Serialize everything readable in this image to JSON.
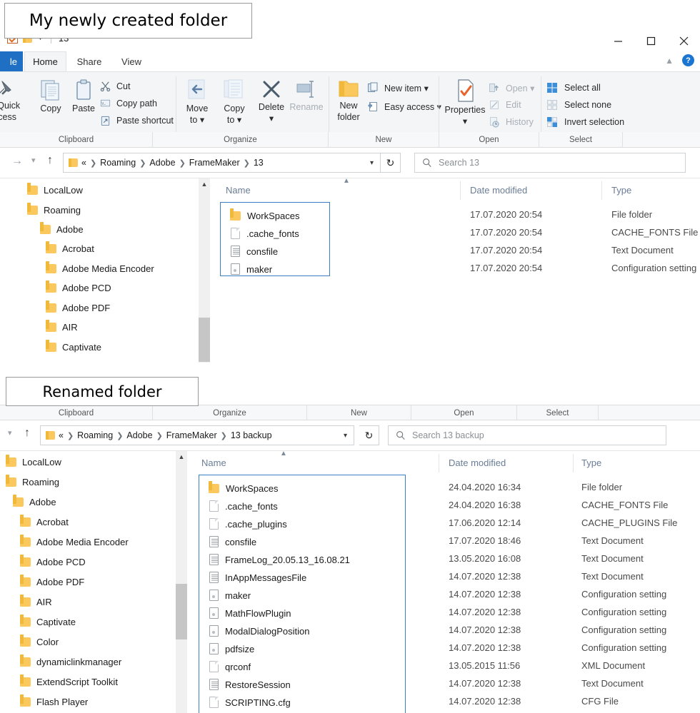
{
  "callouts": {
    "new_folder": "My newly created  folder",
    "renamed_folder": "Renamed folder"
  },
  "colors": {
    "selection_border": "#3c7ec4",
    "file_tab": "#1f6fc4",
    "column_header_text": "#6a7d95",
    "folder_icon": "#fbc85e",
    "help_badge": "#1b76d2"
  },
  "window1": {
    "title": "13",
    "quick_access": {
      "checkmark_icon": "checkmark-icon",
      "folder_icon": "folder-icon",
      "caret_icon": "chevron-down-icon"
    },
    "controls": {
      "minimize": "minimize-icon",
      "maximize": "maximize-icon",
      "close": "close-icon"
    },
    "tabs": [
      {
        "label": "le",
        "name": "tab-file"
      },
      {
        "label": "Home",
        "name": "tab-home"
      },
      {
        "label": "Share",
        "name": "tab-share"
      },
      {
        "label": "View",
        "name": "tab-view"
      }
    ],
    "ribbon_right": {
      "collapse_icon": "chevron-up-icon",
      "help_label": "?"
    },
    "ribbon": {
      "clipboard": {
        "pin_label_line1": "o Quick",
        "pin_label_line2": "ccess",
        "copy_label": "Copy",
        "paste_label": "Paste",
        "cut_label": "Cut",
        "copy_path_label": "Copy path",
        "paste_shortcut_label": "Paste shortcut"
      },
      "organize": {
        "move_to_line1": "Move",
        "move_to_line2": "to",
        "copy_to_line1": "Copy",
        "copy_to_line2": "to",
        "delete_label": "Delete",
        "rename_label": "Rename"
      },
      "new": {
        "new_folder_line1": "New",
        "new_folder_line2": "folder",
        "new_item_label": "New item",
        "easy_access_label": "Easy access"
      },
      "open": {
        "properties_label": "Properties",
        "open_label": "Open",
        "edit_label": "Edit",
        "history_label": "History"
      },
      "select": {
        "select_all_label": "Select all",
        "select_none_label": "Select none",
        "invert_selection_label": "Invert selection"
      },
      "group_labels": [
        "Clipboard",
        "Organize",
        "New",
        "Open",
        "Select"
      ]
    },
    "address": {
      "back_icon": "arrow-right-icon",
      "recent_icon": "chevron-down-icon",
      "up_icon": "arrow-up-icon",
      "folder_icon": "folder-icon",
      "prefix": "«",
      "crumbs": [
        "Roaming",
        "Adobe",
        "FrameMaker",
        "13"
      ],
      "dropdown_icon": "chevron-down-icon",
      "refresh_icon": "refresh-icon",
      "search_placeholder": "Search 13",
      "search_icon": "search-icon"
    },
    "tree": [
      {
        "label": "LocalLow",
        "indent": 0
      },
      {
        "label": "Roaming",
        "indent": 0
      },
      {
        "label": "Adobe",
        "indent": 1
      },
      {
        "label": "Acrobat",
        "indent": 2
      },
      {
        "label": "Adobe Media Encoder",
        "indent": 2
      },
      {
        "label": "Adobe PCD",
        "indent": 2
      },
      {
        "label": "Adobe PDF",
        "indent": 2
      },
      {
        "label": "AIR",
        "indent": 2
      },
      {
        "label": "Captivate",
        "indent": 2
      }
    ],
    "columns": [
      "Name",
      "Date modified",
      "Type"
    ],
    "files": [
      {
        "name": "WorkSpaces",
        "date": "17.07.2020 20:54",
        "type": "File folder",
        "icon": "folder-icon"
      },
      {
        "name": ".cache_fonts",
        "date": "17.07.2020 20:54",
        "type": "CACHE_FONTS File",
        "icon": "blank-file-icon"
      },
      {
        "name": "consfile",
        "date": "17.07.2020 20:54",
        "type": "Text Document",
        "icon": "text-file-icon"
      },
      {
        "name": "maker",
        "date": "17.07.2020 20:54",
        "type": "Configuration setting",
        "icon": "config-file-icon"
      }
    ]
  },
  "window2": {
    "ribbon": {
      "group_labels": [
        "Clipboard",
        "Organize",
        "New",
        "Open",
        "Select"
      ]
    },
    "address": {
      "recent_icon": "chevron-down-icon",
      "up_icon": "arrow-up-icon",
      "folder_icon": "folder-icon",
      "prefix": "«",
      "crumbs": [
        "Roaming",
        "Adobe",
        "FrameMaker",
        "13 backup"
      ],
      "dropdown_icon": "chevron-down-icon",
      "refresh_icon": "refresh-icon",
      "search_placeholder": "Search 13 backup",
      "search_icon": "search-icon"
    },
    "tree": [
      {
        "label": "LocalLow",
        "indent": 0
      },
      {
        "label": "Roaming",
        "indent": 0
      },
      {
        "label": "Adobe",
        "indent": 1
      },
      {
        "label": "Acrobat",
        "indent": 2
      },
      {
        "label": "Adobe Media Encoder",
        "indent": 2
      },
      {
        "label": "Adobe PCD",
        "indent": 2
      },
      {
        "label": "Adobe PDF",
        "indent": 2
      },
      {
        "label": "AIR",
        "indent": 2
      },
      {
        "label": "Captivate",
        "indent": 2
      },
      {
        "label": "Color",
        "indent": 2
      },
      {
        "label": "dynamiclinkmanager",
        "indent": 2
      },
      {
        "label": "ExtendScript Toolkit",
        "indent": 2
      },
      {
        "label": "Flash Player",
        "indent": 2
      }
    ],
    "columns": [
      "Name",
      "Date modified",
      "Type"
    ],
    "files": [
      {
        "name": "WorkSpaces",
        "date": "24.04.2020 16:34",
        "type": "File folder",
        "icon": "folder-icon"
      },
      {
        "name": ".cache_fonts",
        "date": "24.04.2020 16:38",
        "type": "CACHE_FONTS File",
        "icon": "blank-file-icon"
      },
      {
        "name": ".cache_plugins",
        "date": "17.06.2020 12:14",
        "type": "CACHE_PLUGINS File",
        "icon": "blank-file-icon"
      },
      {
        "name": "consfile",
        "date": "17.07.2020 18:46",
        "type": "Text Document",
        "icon": "text-file-icon"
      },
      {
        "name": "FrameLog_20.05.13_16.08.21",
        "date": "13.05.2020 16:08",
        "type": "Text Document",
        "icon": "text-file-icon"
      },
      {
        "name": "InAppMessagesFile",
        "date": "14.07.2020 12:38",
        "type": "Text Document",
        "icon": "text-file-icon"
      },
      {
        "name": "maker",
        "date": "14.07.2020 12:38",
        "type": "Configuration setting",
        "icon": "config-file-icon"
      },
      {
        "name": "MathFlowPlugin",
        "date": "14.07.2020 12:38",
        "type": "Configuration setting",
        "icon": "config-file-icon"
      },
      {
        "name": "ModalDialogPosition",
        "date": "14.07.2020 12:38",
        "type": "Configuration setting",
        "icon": "config-file-icon"
      },
      {
        "name": "pdfsize",
        "date": "14.07.2020 12:38",
        "type": "Configuration setting",
        "icon": "config-file-icon"
      },
      {
        "name": "qrconf",
        "date": "13.05.2015 11:56",
        "type": "XML Document",
        "icon": "blank-file-icon"
      },
      {
        "name": "RestoreSession",
        "date": "14.07.2020 12:38",
        "type": "Text Document",
        "icon": "text-file-icon"
      },
      {
        "name": "SCRIPTING.cfg",
        "date": "14.07.2020 12:38",
        "type": "CFG File",
        "icon": "blank-file-icon"
      }
    ]
  }
}
